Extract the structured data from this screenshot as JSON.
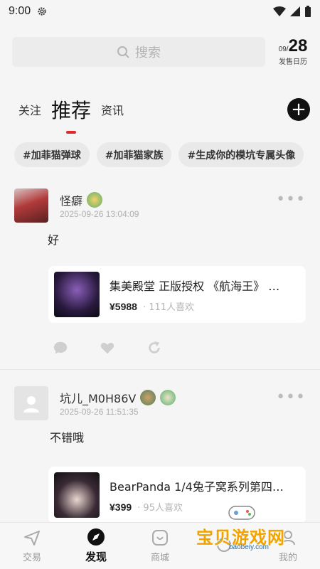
{
  "status": {
    "time": "9:00"
  },
  "search": {
    "placeholder": "搜索"
  },
  "calendar": {
    "month": "09/",
    "day": "28",
    "label": "发售日历"
  },
  "tabs": [
    {
      "label": "关注"
    },
    {
      "label": "推荐"
    },
    {
      "label": "资讯"
    }
  ],
  "chips": [
    "#加菲猫弹球",
    "#加菲猫家族",
    "#生成你的模坑专属头像"
  ],
  "posts": [
    {
      "username": "怪癖",
      "time": "2025-09-26 13:04:09",
      "text": "好",
      "product": {
        "title": "集美殿堂 正版授权 《航海王》 …",
        "price": "¥5988",
        "likes": "· 111人喜欢"
      }
    },
    {
      "username": "坑儿_M0H86V",
      "time": "2025-09-26 11:51:35",
      "text": "不错哦",
      "product": {
        "title": "BearPanda 1/4兔子窝系列第四…",
        "price": "¥399",
        "likes": "· 95人喜欢"
      }
    }
  ],
  "nav": [
    {
      "label": "交易",
      "icon": "send-icon"
    },
    {
      "label": "发现",
      "icon": "compass-icon"
    },
    {
      "label": "商城",
      "icon": "smile-bag-icon"
    },
    {
      "label": "",
      "icon": "community-icon"
    },
    {
      "label": "我的",
      "icon": "profile-icon"
    }
  ],
  "watermark": {
    "text": "宝贝游戏网",
    "url": "baobeiy.com"
  },
  "colors": {
    "accent": "#e02a2a",
    "background": "#f5f5f5"
  }
}
